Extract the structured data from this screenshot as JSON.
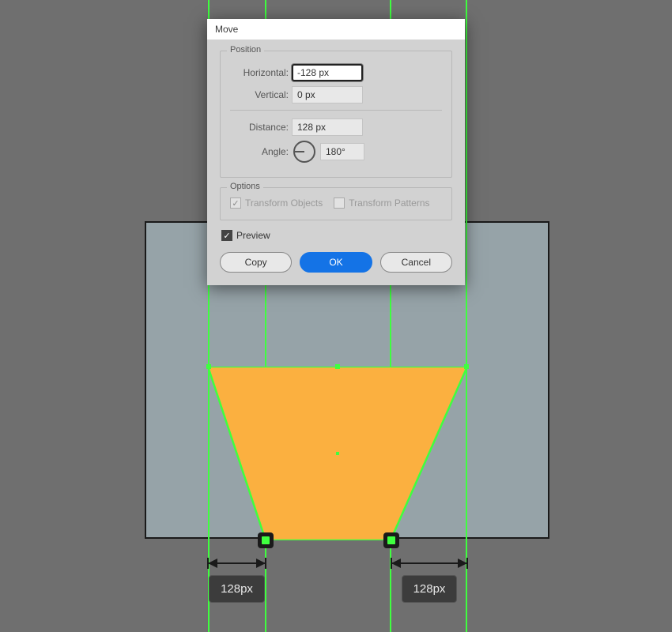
{
  "dialog": {
    "title": "Move",
    "position_group": "Position",
    "horizontal_label": "Horizontal:",
    "horizontal_value": "-128 px",
    "vertical_label": "Vertical:",
    "vertical_value": "0 px",
    "distance_label": "Distance:",
    "distance_value": "128 px",
    "angle_label": "Angle:",
    "angle_value": "180°",
    "options_group": "Options",
    "transform_objects": "Transform Objects",
    "transform_patterns": "Transform Patterns",
    "preview_label": "Preview",
    "copy_label": "Copy",
    "ok_label": "OK",
    "cancel_label": "Cancel"
  },
  "annotations": {
    "left_measure": "128px",
    "right_measure": "128px"
  },
  "guides_x": [
    263,
    335,
    493,
    590
  ],
  "shape": {
    "fill": "#fbb040",
    "stroke": "#3fff3f"
  }
}
